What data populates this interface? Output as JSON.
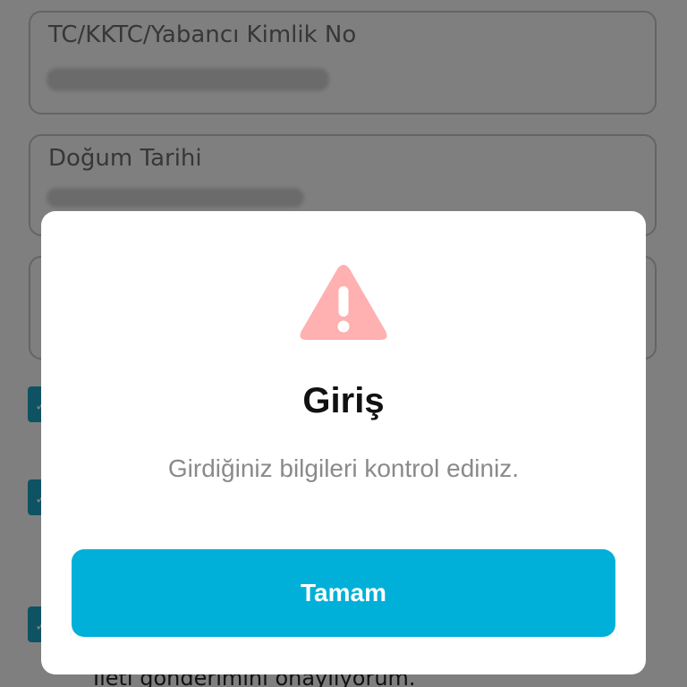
{
  "form": {
    "id_field_label": "TC/KKTC/Yabancı Kimlik No",
    "birth_field_label": "Doğum Tarihi",
    "consent_text": "İleti gönderimini onaylıyorum."
  },
  "dialog": {
    "icon": "warning-triangle-icon",
    "title": "Giriş",
    "message": "Girdiğiniz bilgileri kontrol ediniz.",
    "ok_label": "Tamam"
  },
  "colors": {
    "accent": "#00b0d8",
    "warning": "#ffb0b0",
    "overlay": "rgba(0,0,0,0.5)"
  }
}
